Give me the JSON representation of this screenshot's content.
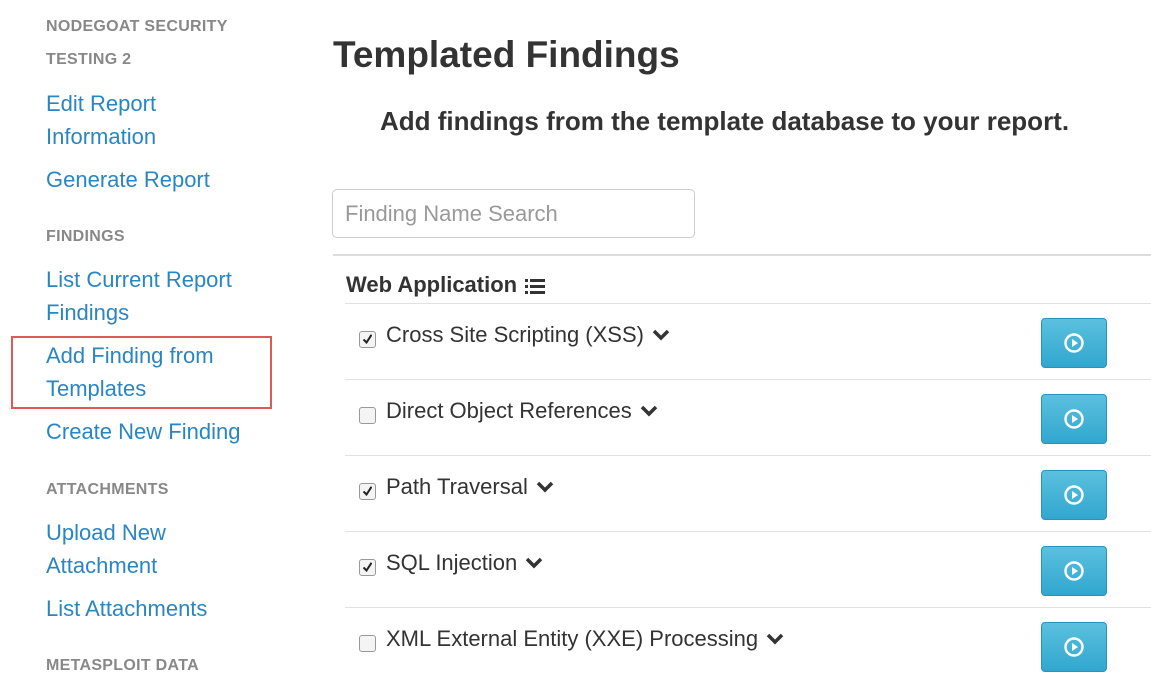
{
  "sidebar": {
    "report_header_line1": "NODEGOAT SECURITY",
    "report_header_line2": "TESTING 2",
    "edit_report_line1": "Edit Report",
    "edit_report_line2": "Information",
    "generate_report": "Generate Report",
    "findings_header": "FINDINGS",
    "list_findings_line1": "List Current Report",
    "list_findings_line2": "Findings",
    "add_from_templates_line1": "Add Finding from",
    "add_from_templates_line2": "Templates",
    "create_new_finding": "Create New Finding",
    "attachments_header": "ATTACHMENTS",
    "upload_line1": "Upload New",
    "upload_line2": "Attachment",
    "list_attachments": "List Attachments",
    "metasploit_header": "METASPLOIT DATA"
  },
  "main": {
    "title": "Templated Findings",
    "subtitle": "Add findings from the template database to your report.",
    "search_placeholder": "Finding Name Search",
    "category": "Web Application",
    "findings": [
      {
        "name": "Cross Site Scripting (XSS)",
        "checked": true
      },
      {
        "name": "Direct Object References",
        "checked": false
      },
      {
        "name": "Path Traversal",
        "checked": true
      },
      {
        "name": "SQL Injection",
        "checked": true
      },
      {
        "name": "XML External Entity (XXE) Processing",
        "checked": false
      }
    ]
  },
  "colors": {
    "link": "#2a86c2",
    "header_gray": "#888888",
    "highlight_box": "#e05a55",
    "button": "#31a7cf"
  },
  "icons": {
    "category": "list-icon",
    "expand": "chevron-down-icon",
    "preview": "play-circle-icon",
    "checkbox": "checkmark-icon"
  }
}
